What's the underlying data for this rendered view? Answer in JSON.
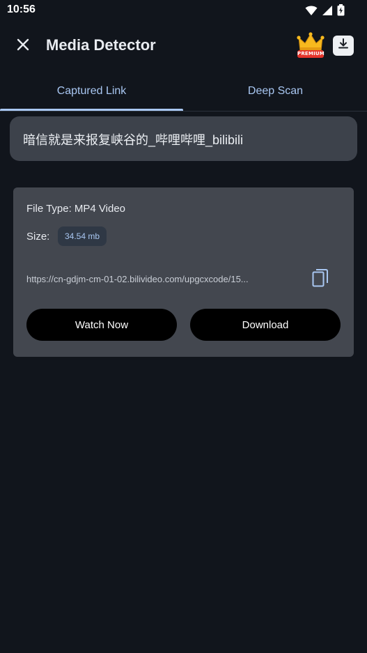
{
  "status_bar": {
    "time": "10:56",
    "icons": [
      "wifi-icon",
      "signal-icon",
      "battery-icon"
    ]
  },
  "app_bar": {
    "title": "Media Detector",
    "close_icon": "close-icon",
    "premium_label": "PREMIUM",
    "premium_icon": "crown-icon",
    "download_icon": "download-icon"
  },
  "tabs": [
    {
      "label": "Captured Link",
      "selected": true
    },
    {
      "label": "Deep Scan",
      "selected": false
    }
  ],
  "page": {
    "title": "暗信就是来报复峡谷的_哔哩哔哩_bilibili"
  },
  "media": {
    "file_type": "File Type: MP4 Video",
    "size_label": "Size:",
    "size_value": "34.54 mb",
    "url": "https://cn-gdjm-cm-01-02.bilivideo.com/upgcxcode/15...",
    "copy_icon": "copy-icon",
    "watch_label": "Watch Now",
    "download_label": "Download"
  },
  "colors": {
    "background": "#11151c",
    "accent": "#a9c7f2",
    "card": "#43474f",
    "title_card": "#3d424b",
    "premium_red": "#e4342b",
    "crown_gold": "#f7b91e"
  }
}
